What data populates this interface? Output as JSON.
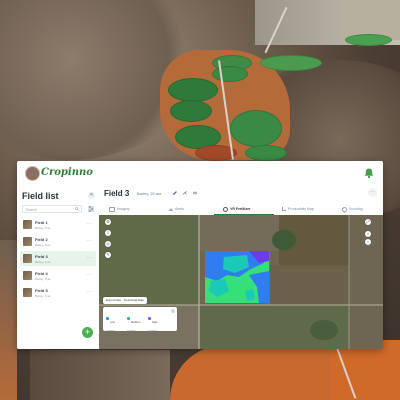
{
  "app": {
    "logo_text": "Cropinno"
  },
  "sidebar": {
    "title": "Field list",
    "search_placeholder": "Search",
    "fields": [
      {
        "name": "Field 1",
        "meta": "Barley, 8 ac",
        "active": false
      },
      {
        "name": "Field 2",
        "meta": "Barley, 8 ac",
        "active": false
      },
      {
        "name": "Field 3",
        "meta": "Barley, 8 ac",
        "active": true
      },
      {
        "name": "Field 4",
        "meta": "Barley, 8 ac",
        "active": false
      },
      {
        "name": "Field 5",
        "meta": "Barley, 8 ac",
        "active": false
      }
    ],
    "more_glyph": "···",
    "add_glyph": "+"
  },
  "field_header": {
    "title": "Field 3",
    "meta": "Barley, 20 acr",
    "menu_glyph": "···"
  },
  "tabs": [
    {
      "label": "Imagery",
      "active": false
    },
    {
      "label": "Alerts",
      "active": false
    },
    {
      "label": "VR Fertilizer",
      "active": true
    },
    {
      "label": "Productivity Map",
      "active": false
    },
    {
      "label": "Scouting",
      "active": false
    }
  ],
  "map": {
    "buttons": [
      "Export Data",
      "Download Map"
    ],
    "zoom_in": "+",
    "zoom_out": "−",
    "legend": [
      {
        "label": "Low",
        "value": "0.00000",
        "color": "#1e88e5"
      },
      {
        "label": "Medium",
        "value": "0.00000",
        "color": "#26a69a"
      },
      {
        "label": "High",
        "value": "0.00000",
        "color": "#7c4dff"
      }
    ],
    "zone_colors": {
      "low": "#2f7df0",
      "mid": "#1bc9b8",
      "high": "#35e07a",
      "peak": "#6a3de8"
    }
  },
  "colors": {
    "brand": "#2e7d32",
    "accent": "#4caf50"
  }
}
